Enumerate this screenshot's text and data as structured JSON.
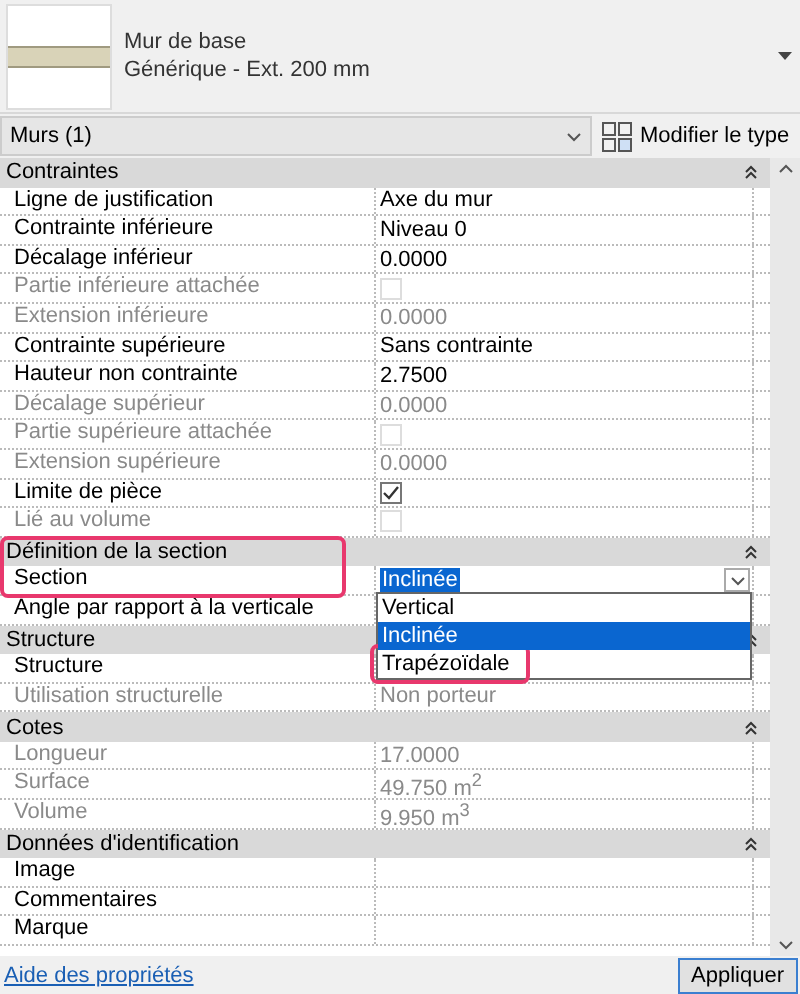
{
  "type_selector": {
    "name": "Mur de base",
    "type": "Générique - Ext. 200 mm"
  },
  "filter": {
    "value": "Murs (1)",
    "button": "Modifier le type"
  },
  "sections": [
    {
      "title": "Contraintes",
      "highlighted": false,
      "rows": [
        {
          "label": "Ligne de justification",
          "kind": "text",
          "value": "Axe du mur",
          "disabled": false
        },
        {
          "label": "Contrainte inférieure",
          "kind": "text",
          "value": "Niveau 0",
          "disabled": false
        },
        {
          "label": "Décalage inférieur",
          "kind": "text",
          "value": "0.0000",
          "disabled": false
        },
        {
          "label": "Partie inférieure attachée",
          "kind": "checkbox",
          "checked": false,
          "disabled": true
        },
        {
          "label": "Extension inférieure",
          "kind": "text",
          "value": "0.0000",
          "disabled": true
        },
        {
          "label": "Contrainte supérieure",
          "kind": "text",
          "value": "Sans contrainte",
          "disabled": false
        },
        {
          "label": "Hauteur non contrainte",
          "kind": "text",
          "value": "2.7500",
          "disabled": false
        },
        {
          "label": "Décalage supérieur",
          "kind": "text",
          "value": "0.0000",
          "disabled": true
        },
        {
          "label": "Partie supérieure attachée",
          "kind": "checkbox",
          "checked": false,
          "disabled": true
        },
        {
          "label": "Extension supérieure",
          "kind": "text",
          "value": "0.0000",
          "disabled": true
        },
        {
          "label": "Limite de pièce",
          "kind": "checkbox",
          "checked": true,
          "disabled": false
        },
        {
          "label": "Lié au volume",
          "kind": "checkbox",
          "checked": false,
          "disabled": true
        }
      ]
    },
    {
      "title": "Définition de la section",
      "highlighted": true,
      "rows": [
        {
          "label": "Section",
          "kind": "select",
          "value": "Inclinée",
          "disabled": false,
          "expanded": true,
          "options": [
            {
              "label": "Vertical",
              "selected": false,
              "highlighted": false
            },
            {
              "label": "Inclinée",
              "selected": true,
              "highlighted": false
            },
            {
              "label": "Trapézoïdale",
              "selected": false,
              "highlighted": true
            }
          ]
        },
        {
          "label": "Angle par rapport à la verticale",
          "kind": "text",
          "disabled": false
        }
      ]
    },
    {
      "title": "Structure",
      "highlighted": false,
      "rows": [
        {
          "label": "Structure",
          "kind": "text",
          "disabled": false
        },
        {
          "label": "Utilisation structurelle",
          "kind": "text",
          "value": "Non porteur",
          "disabled": true
        }
      ]
    },
    {
      "title": "Cotes",
      "highlighted": false,
      "rows": [
        {
          "label": "Longueur",
          "kind": "text",
          "value": "17.0000",
          "disabled": true
        },
        {
          "label": "Surface",
          "kind": "text",
          "value": "49.750 m$^{2}$",
          "disabled": true
        },
        {
          "label": "Volume",
          "kind": "text",
          "value": "9.950 m$^{3}$",
          "disabled": true
        }
      ]
    },
    {
      "title": "Données d'identification",
      "highlighted": false,
      "rows": [
        {
          "label": "Image",
          "kind": "text",
          "disabled": false
        },
        {
          "label": "Commentaires",
          "kind": "text",
          "disabled": false
        },
        {
          "label": "Marque",
          "kind": "text",
          "disabled": false
        }
      ]
    }
  ],
  "footer": {
    "link": "Aide des propriétés",
    "button": "Appliquer"
  }
}
